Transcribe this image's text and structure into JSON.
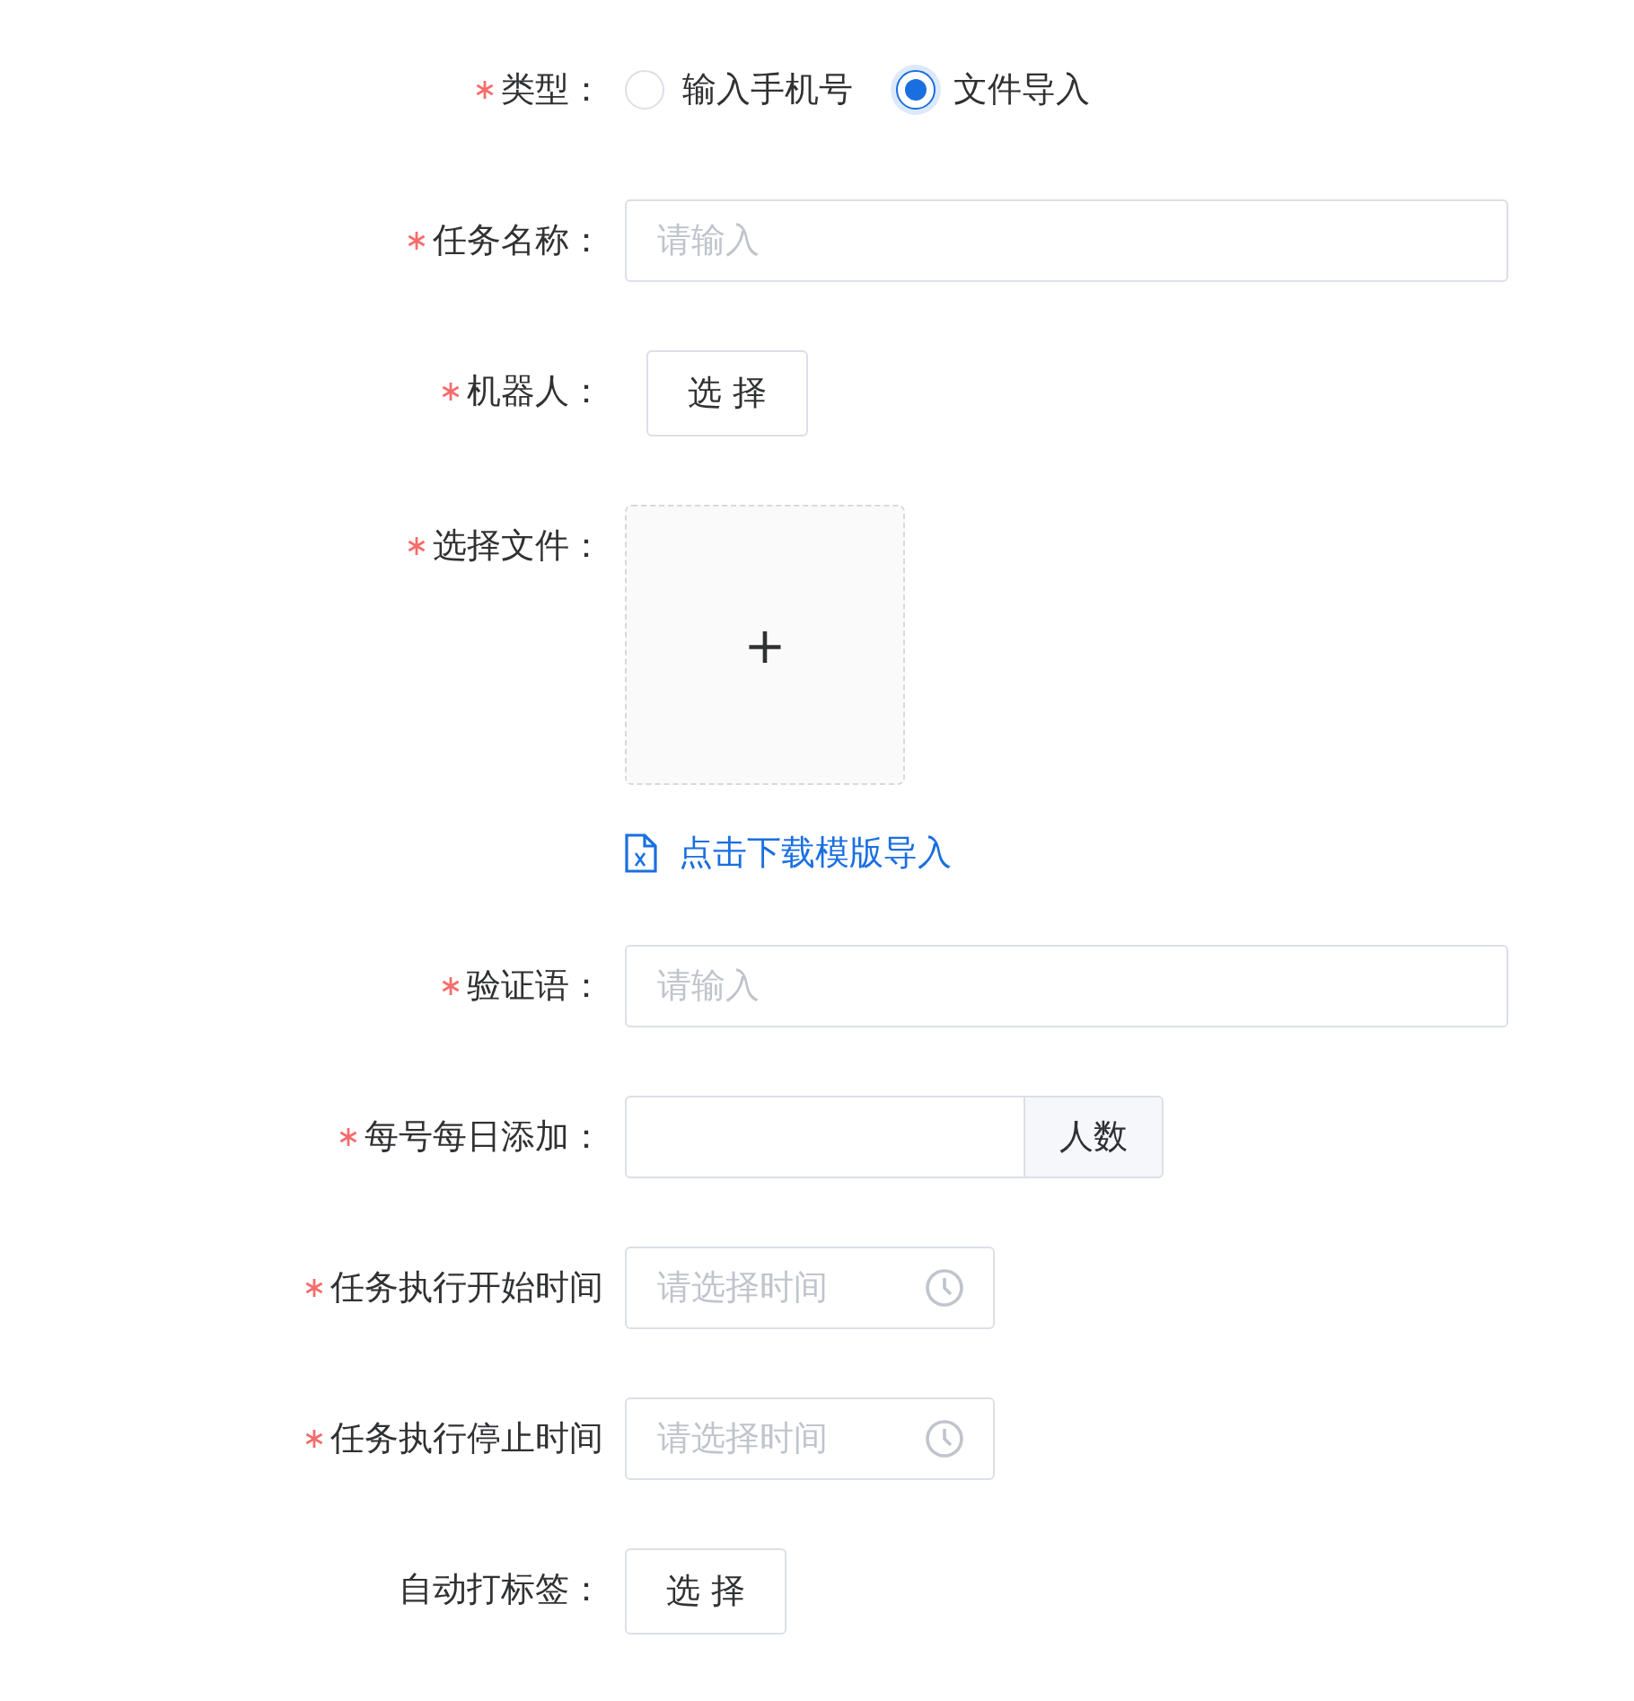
{
  "form": {
    "fields": [
      {
        "kind": "radio",
        "label": "类型：",
        "required": true,
        "options": [
          {
            "label": "输入手机号",
            "selected": false
          },
          {
            "label": "文件导入",
            "selected": true
          }
        ]
      },
      {
        "kind": "input",
        "label": "任务名称：",
        "required": true,
        "placeholder": "请输入"
      },
      {
        "kind": "button",
        "label": "机器人：",
        "required": true,
        "button": "选 择"
      },
      {
        "kind": "upload",
        "label": "选择文件：",
        "required": true,
        "icon": "+",
        "link": "点击下载模版导入"
      },
      {
        "kind": "input",
        "label": "验证语：",
        "required": true,
        "placeholder": "请输入"
      },
      {
        "kind": "suffix_input",
        "label": "每号每日添加：",
        "required": true,
        "suffix": "人数"
      },
      {
        "kind": "time",
        "label": "任务执行开始时间",
        "required": true,
        "placeholder": "请选择时间"
      },
      {
        "kind": "time",
        "label": "任务执行停止时间",
        "required": true,
        "placeholder": "请选择时间"
      },
      {
        "kind": "button",
        "label": "自动打标签：",
        "required": false,
        "button": "选 择"
      }
    ]
  }
}
